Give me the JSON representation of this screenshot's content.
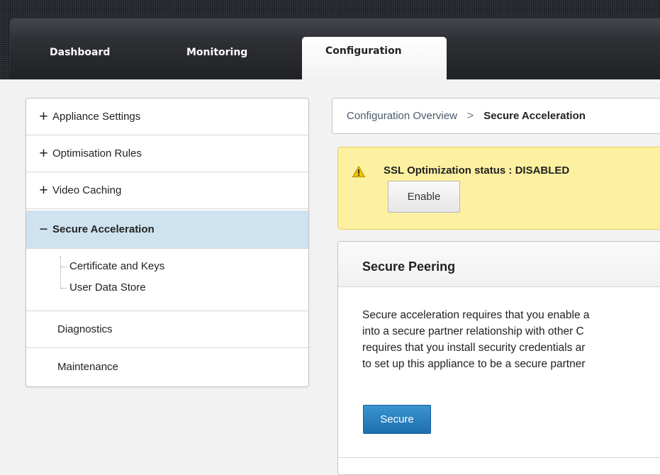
{
  "nav": {
    "tabs": [
      {
        "label": "Dashboard"
      },
      {
        "label": "Monitoring"
      },
      {
        "label": "Configuration",
        "active": true
      }
    ]
  },
  "sidebar": {
    "items": [
      {
        "sign": "+",
        "label": "Appliance Settings"
      },
      {
        "sign": "+",
        "label": "Optimisation Rules"
      },
      {
        "sign": "+",
        "label": "Video Caching"
      },
      {
        "sign": "−",
        "label": "Secure Acceleration",
        "active": true
      }
    ],
    "sub_items": [
      {
        "label": "Certificate and Keys"
      },
      {
        "label": "User Data Store"
      }
    ],
    "plain_items": [
      {
        "label": "Diagnostics"
      },
      {
        "label": "Maintenance"
      }
    ]
  },
  "breadcrumb": {
    "parent": "Configuration Overview",
    "separator": ">",
    "current": "Secure Acceleration"
  },
  "warning": {
    "icon": "warning-triangle-icon",
    "text": "SSL Optimization status : DISABLED",
    "button_label": "Enable",
    "color": "#fdf1a1"
  },
  "panel": {
    "title": "Secure Peering",
    "body_lines": [
      "Secure acceleration requires that you enable a",
      "into a secure partner relationship with other C",
      "requires that you install security credentials ar",
      "to set up this appliance to be a secure partner"
    ],
    "button_label": "Secure",
    "button_color": "#2a7fbf"
  },
  "colors": {
    "active_sidebar": "#cfe2ef",
    "nav_bg": "#1f2125"
  }
}
